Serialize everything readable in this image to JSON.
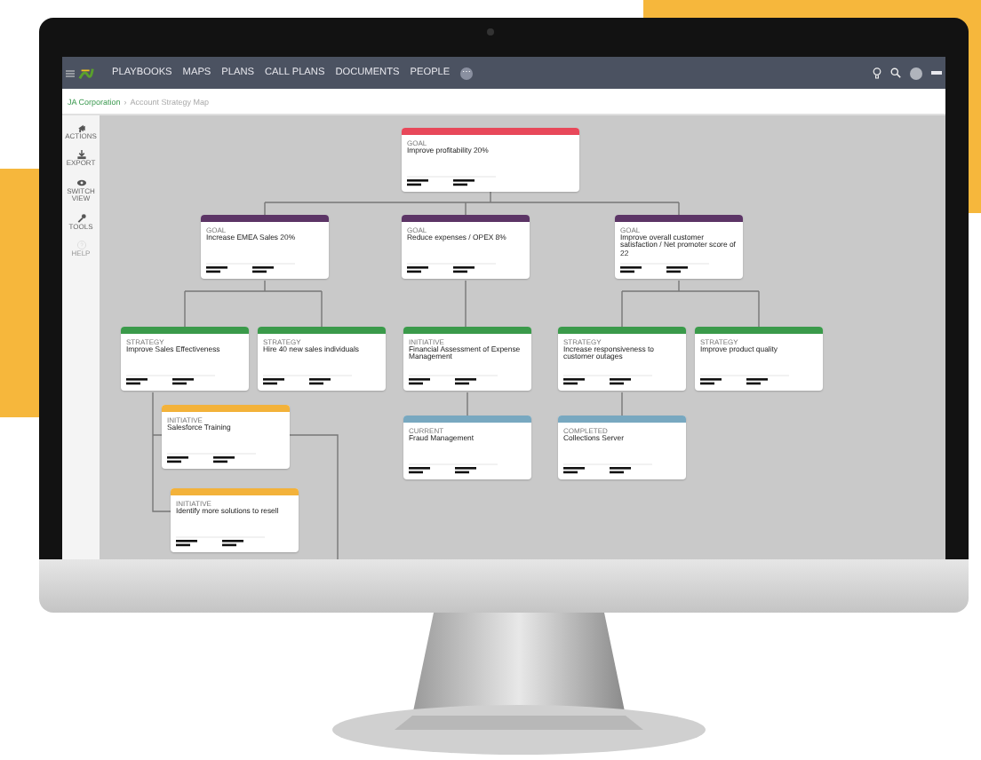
{
  "nav": {
    "items": [
      "PLAYBOOKS",
      "MAPS",
      "PLANS",
      "CALL PLANS",
      "DOCUMENTS",
      "PEOPLE"
    ],
    "more": "⋯"
  },
  "breadcrumb": [
    {
      "label": "JA Corporation",
      "link": true
    },
    {
      "label": "›",
      "link": false
    },
    {
      "label": "Account Strategy Map",
      "link": false
    }
  ],
  "sidebar": [
    {
      "kind": "actions",
      "label": "ACTIONS",
      "disabled": false
    },
    {
      "kind": "export",
      "label": "EXPORT",
      "disabled": false
    },
    {
      "kind": "view",
      "label": "SWITCH VIEW",
      "disabled": false
    },
    {
      "kind": "tools",
      "label": "TOOLS",
      "disabled": false
    },
    {
      "kind": "help",
      "label": "HELP",
      "disabled": true
    }
  ],
  "cards": [
    {
      "type": "GOAL",
      "title": "Improve profitability 20%",
      "color": "#e8485a"
    },
    {
      "type": "GOAL",
      "title": "Increase EMEA Sales 20%",
      "color": "#5c3566"
    },
    {
      "type": "GOAL",
      "title": "Reduce expenses / OPEX 8%",
      "color": "#5c3566"
    },
    {
      "type": "GOAL",
      "title": "Improve overall customer satisfaction / Net promoter score of 22",
      "color": "#5c3566"
    },
    {
      "type": "STRATEGY",
      "title": "Improve Sales Effectiveness",
      "color": "#3a9a4a"
    },
    {
      "type": "STRATEGY",
      "title": "Hire 40 new sales individuals",
      "color": "#3a9a4a"
    },
    {
      "type": "INITIATIVE",
      "title": "Financial Assessment of Expense Management",
      "color": "#3a9a4a"
    },
    {
      "type": "STRATEGY",
      "title": "Increase responsiveness to customer outages",
      "color": "#3a9a4a"
    },
    {
      "type": "STRATEGY",
      "title": "Improve product quality",
      "color": "#3a9a4a"
    },
    {
      "type": "INITIATIVE",
      "title": "Salesforce Training",
      "color": "#f3b23a"
    },
    {
      "type": "CURRENT",
      "title": "Fraud Management",
      "color": "#78a8c0"
    },
    {
      "type": "COMPLETED",
      "title": "Collections Server",
      "color": "#78a8c0"
    },
    {
      "type": "INITIATIVE",
      "title": "Identify more solutions to resell",
      "color": "#f3b23a"
    }
  ]
}
